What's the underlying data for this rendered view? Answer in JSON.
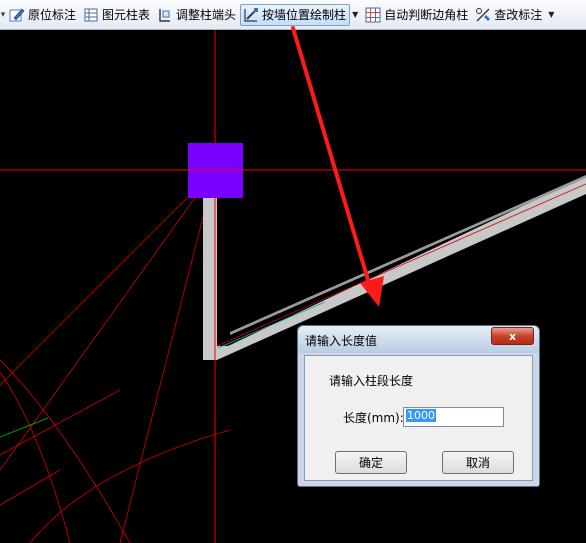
{
  "toolbar": {
    "items": [
      {
        "label": "原位标注",
        "icon": "pencil-grid-icon"
      },
      {
        "label": "图元柱表",
        "icon": "table-icon"
      },
      {
        "label": "调整柱端头",
        "icon": "column-end-icon"
      },
      {
        "label": "按墙位置绘制柱",
        "icon": "draw-column-icon",
        "active": true
      },
      {
        "label": "自动判断边角柱",
        "icon": "grid-icon"
      },
      {
        "label": "查改标注",
        "icon": "edit-annotation-icon"
      }
    ]
  },
  "dialog": {
    "title": "请输入长度值",
    "close_label": "x",
    "prompt": "请输入柱段长度",
    "length_label": "长度(mm):",
    "length_value": "1000",
    "ok_label": "确定",
    "cancel_label": "取消"
  },
  "colors": {
    "canvas_bg": "#000000",
    "column": "#7a00ff",
    "wall": "#c8c8c8",
    "axis": "#ff0000",
    "arrow": "#ff1a1a"
  }
}
